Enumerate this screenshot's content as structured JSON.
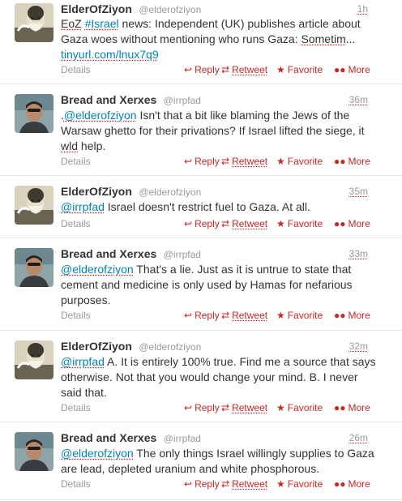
{
  "ui": {
    "details_label": "Details",
    "reply_label": "Reply",
    "retweet_label": "Retweet",
    "favorite_label": "Favorite",
    "more_label": "More",
    "link_color": "#0084b4",
    "action_color": "#c62828"
  },
  "tweets": [
    {
      "name": "ElderOfZiyon",
      "handle": "@elderofziyon",
      "time": "1h",
      "avatar": "elder-avatar",
      "text": "EoZ #Israel news: Independent (UK) publishes article about Gaza woes without mentioning who runs Gaza: Sometim... tinyurl.com/lnux7q9"
    },
    {
      "name": "Bread and Xerxes",
      "handle": "@irrpfad",
      "time": "36m",
      "avatar": "person-avatar",
      "text": ".@elderofziyon Isn't that a bit like blaming the Jews of the Warsaw ghetto for their privations? If Israel lifted the siege, it wld help."
    },
    {
      "name": "ElderOfZiyon",
      "handle": "@elderofziyon",
      "time": "35m",
      "avatar": "elder-avatar",
      "text": "@irrpfad Israel doesn't restrict fuel to Gaza. At all."
    },
    {
      "name": "Bread and Xerxes",
      "handle": "@irrpfad",
      "time": "33m",
      "avatar": "person-avatar",
      "text": "@elderofziyon That's a lie. Just as it is untrue to state that cement and medicine is only used by Hamas for nefarious purposes."
    },
    {
      "name": "ElderOfZiyon",
      "handle": "@elderofziyon",
      "time": "32m",
      "avatar": "elder-avatar",
      "text": "@irrpfad A. It is entirely 100% true. Find me a source that says otherwise. Not that you would change your mind. B. I never said that."
    },
    {
      "name": "Bread and Xerxes",
      "handle": "@irrpfad",
      "time": "26m",
      "avatar": "person-avatar",
      "text": "@elderofziyon The only things Israel willingly supplies to Gaza are lead, depleted uranium and white phosphorous."
    }
  ]
}
